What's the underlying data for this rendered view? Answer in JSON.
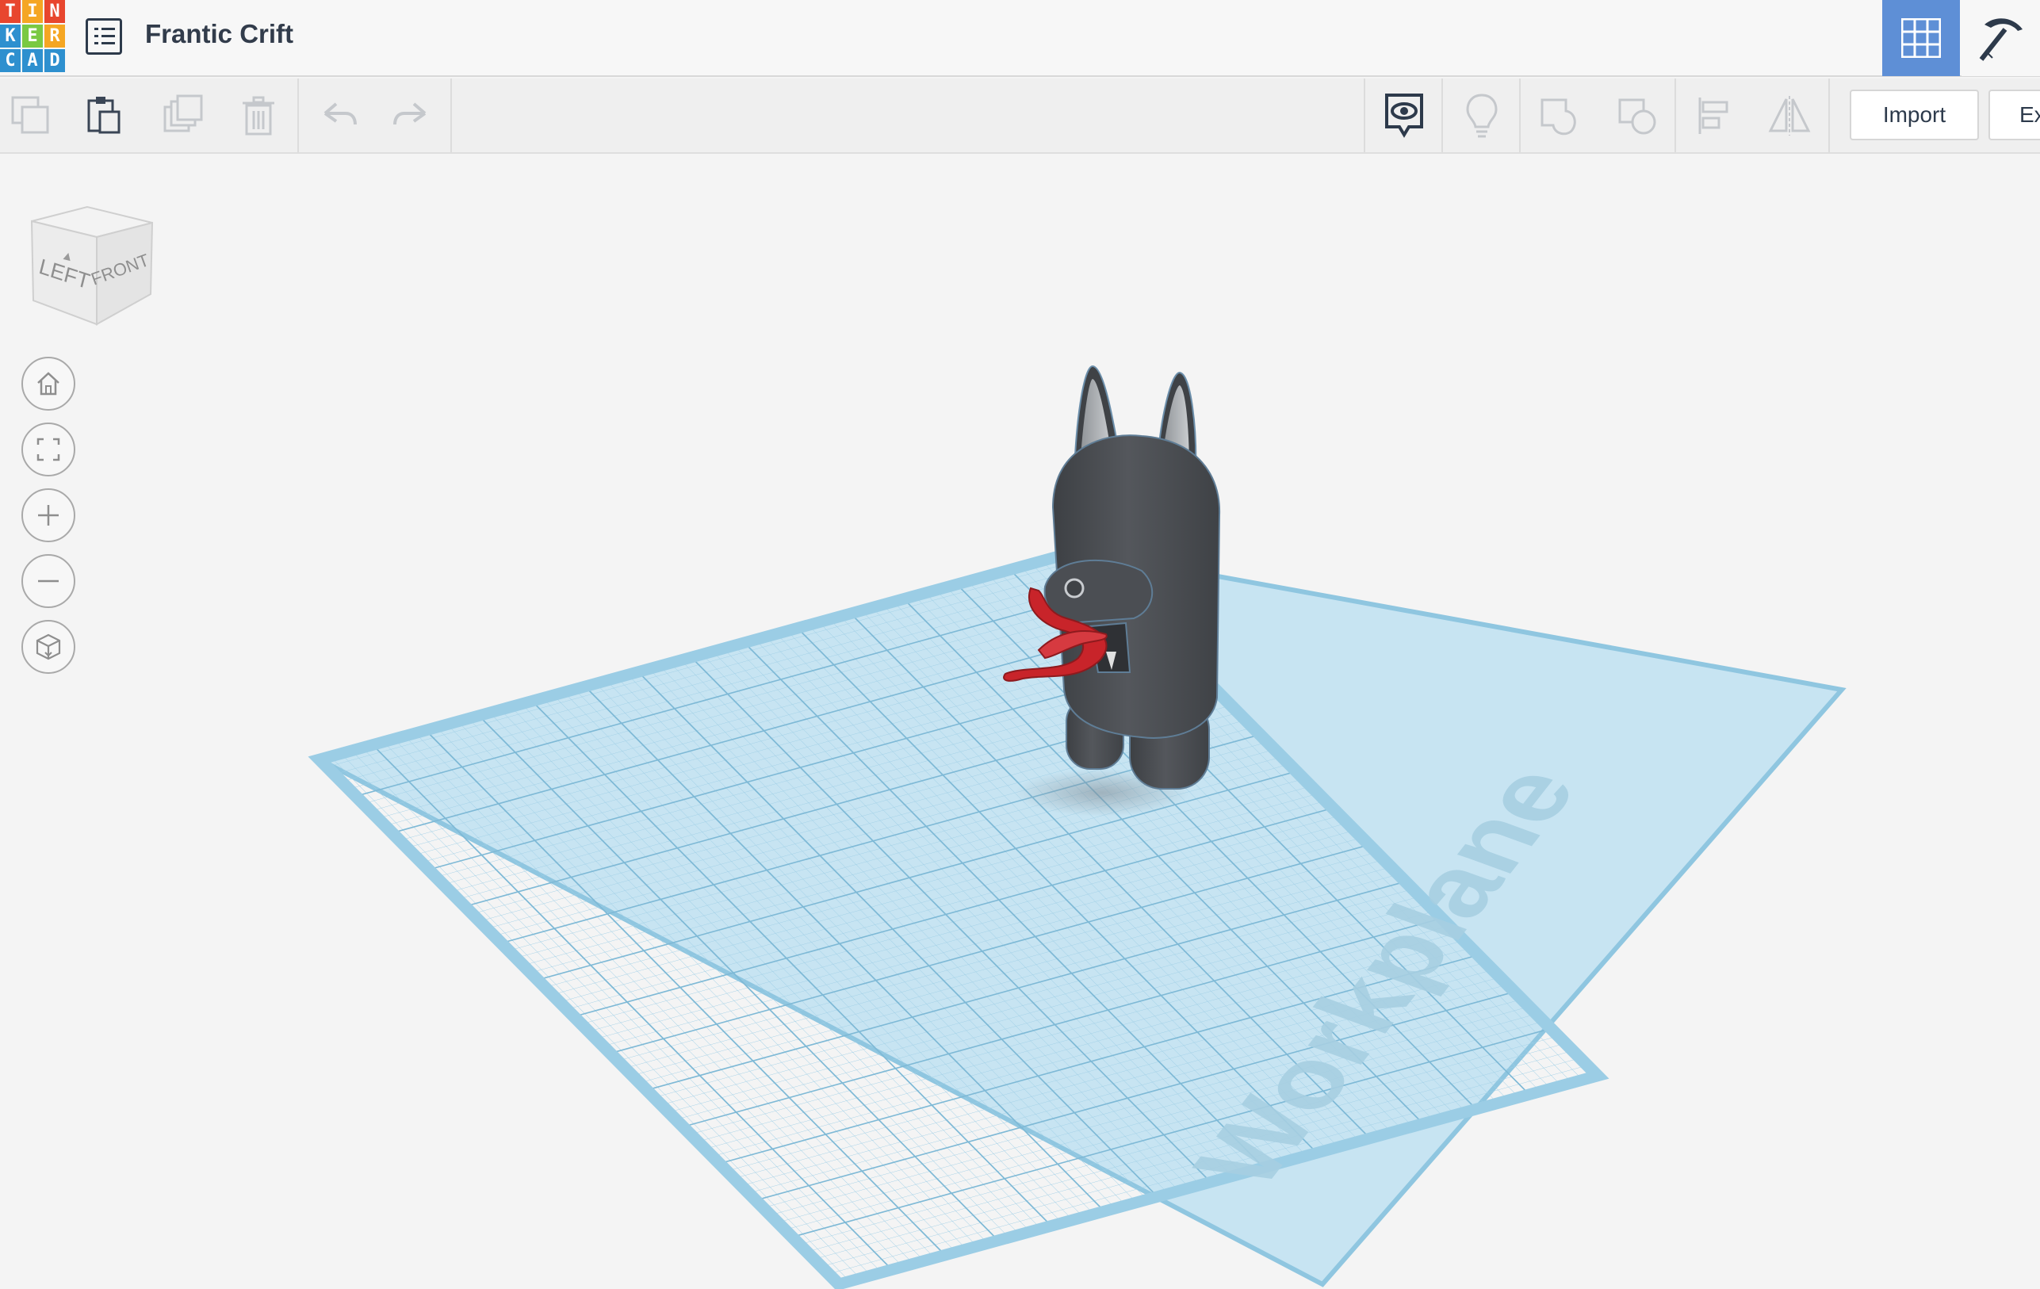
{
  "header": {
    "logo_letters": [
      "T",
      "I",
      "N",
      "K",
      "E",
      "R",
      "C",
      "A",
      "D"
    ],
    "logo_colors": [
      "#e8462e",
      "#f5a623",
      "#e8462e",
      "#2e90cf",
      "#7ac943",
      "#f5a623",
      "#2e90cf",
      "#2e90cf",
      "#2e90cf"
    ],
    "project_name": "Frantic Crift",
    "icons": {
      "menu": "list-icon",
      "grid_view": "grid-view-icon",
      "minecraft": "pickaxe-icon"
    },
    "accent_color": "#5e8fd6"
  },
  "toolbar": {
    "left_tools": [
      "copy-icon",
      "paste-icon",
      "duplicate-icon",
      "delete-icon",
      "undo-icon",
      "redo-icon"
    ],
    "right_tools": [
      "show-all-icon",
      "notes-icon",
      "group-icon",
      "ungroup-icon",
      "align-icon",
      "mirror-icon"
    ],
    "import_label": "Import",
    "export_label": "Ex"
  },
  "viewport": {
    "view_cube": {
      "left_label": "LEFT",
      "front_label": "FRONT"
    },
    "nav_controls": [
      "home-view-icon",
      "fit-view-icon",
      "zoom-in-icon",
      "zoom-out-icon",
      "ortho-view-icon"
    ],
    "workplane_label": "Workplane",
    "model_colors": {
      "body": "#4a4d52",
      "tongue": "#c8242a",
      "workplane": "#bfe0f0"
    }
  }
}
